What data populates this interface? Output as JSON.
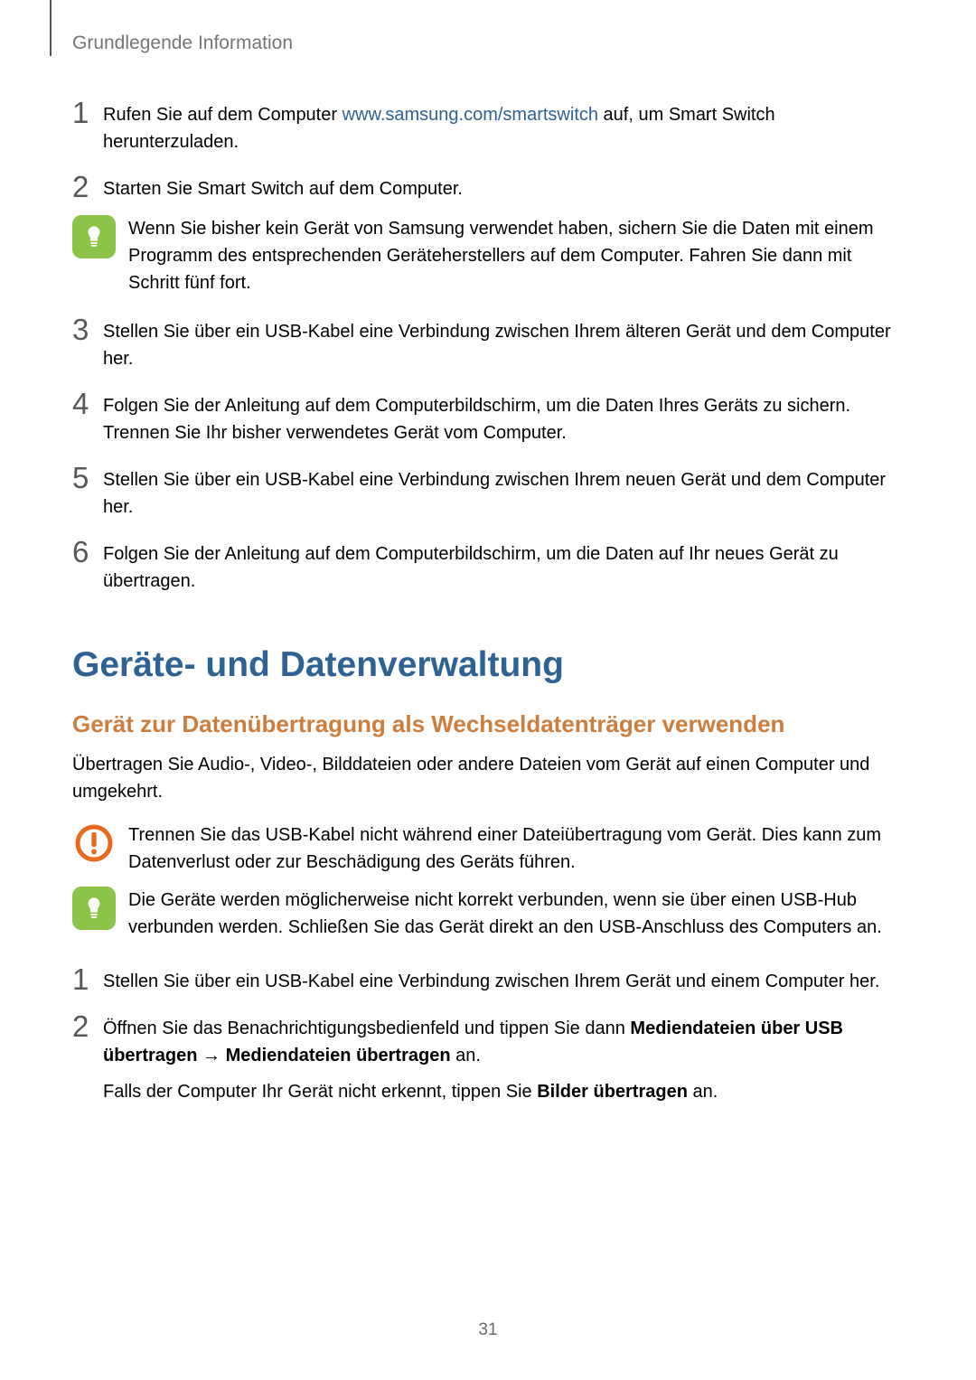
{
  "header": {
    "breadcrumb": "Grundlegende Information"
  },
  "steps1": {
    "s1_a": "Rufen Sie auf dem Computer ",
    "s1_link": "www.samsung.com/smartswitch",
    "s1_b": " auf, um Smart Switch herunterzuladen.",
    "n1": "1",
    "s2": "Starten Sie Smart Switch auf dem Computer.",
    "n2": "2",
    "note1": "Wenn Sie bisher kein Gerät von Samsung verwendet haben, sichern Sie die Daten mit einem Programm des entsprechenden Geräteherstellers auf dem Computer. Fahren Sie dann mit Schritt fünf fort.",
    "s3": "Stellen Sie über ein USB-Kabel eine Verbindung zwischen Ihrem älteren Gerät und dem Computer her.",
    "n3": "3",
    "s4": "Folgen Sie der Anleitung auf dem Computerbildschirm, um die Daten Ihres Geräts zu sichern. Trennen Sie Ihr bisher verwendetes Gerät vom Computer.",
    "n4": "4",
    "s5": "Stellen Sie über ein USB-Kabel eine Verbindung zwischen Ihrem neuen Gerät und dem Computer her.",
    "n5": "5",
    "s6": "Folgen Sie der Anleitung auf dem Computerbildschirm, um die Daten auf Ihr neues Gerät zu übertragen.",
    "n6": "6"
  },
  "section": {
    "h1": "Geräte- und Datenverwaltung",
    "h2": "Gerät zur Datenübertragung als Wechseldatenträger verwenden",
    "intro": "Übertragen Sie Audio-, Video-, Bilddateien oder andere Dateien vom Gerät auf einen Computer und umgekehrt.",
    "warn": "Trennen Sie das USB-Kabel nicht während einer Dateiübertragung vom Gerät. Dies kann zum Datenverlust oder zur Beschädigung des Geräts führen.",
    "note2": "Die Geräte werden möglicherweise nicht korrekt verbunden, wenn sie über einen USB-Hub verbunden werden. Schließen Sie das Gerät direkt an den USB-Anschluss des Computers an."
  },
  "steps2": {
    "n1": "1",
    "s1": "Stellen Sie über ein USB-Kabel eine Verbindung zwischen Ihrem Gerät und einem Computer her.",
    "n2": "2",
    "s2_a": "Öffnen Sie das Benachrichtigungsbedienfeld und tippen Sie dann ",
    "s2_b1": "Mediendateien über USB übertragen",
    "s2_arrow": " → ",
    "s2_b2": "Mediendateien übertragen",
    "s2_c": " an.",
    "s2_d": "Falls der Computer Ihr Gerät nicht erkennt, tippen Sie ",
    "s2_e": "Bilder übertragen",
    "s2_f": " an."
  },
  "page": "31"
}
